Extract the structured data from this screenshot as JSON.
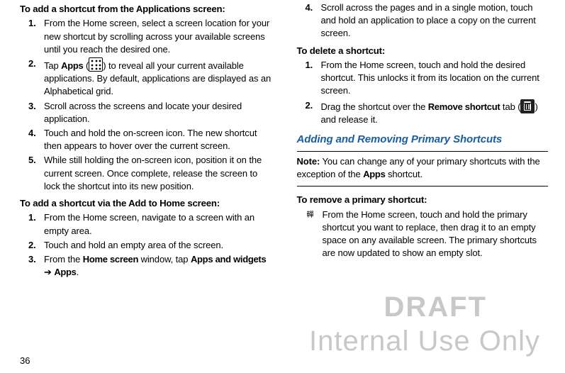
{
  "watermark": {
    "line1": "DRAFT",
    "line2": "Internal Use Only"
  },
  "pageNumber": "36",
  "left": {
    "heading1": "To add a shortcut from the Applications screen:",
    "steps1": [
      "From the Home screen, select a screen location for your new shortcut by scrolling across your available screens until you reach the desired one.",
      "Tap <b>Apps</b> (<span class=\"icon-grid\" data-name=\"apps-grid-icon\" data-interactable=\"false\"></span>) to reveal all your current available applications. By default, applications are displayed as an Alphabetical grid.",
      "Scroll across the screens and locate your desired application.",
      "Touch and hold the on-screen icon. The new shortcut then appears to hover over the current screen.",
      "While still holding the on-screen icon, position it on the current screen. Once complete, release the screen to lock the shortcut into its new position."
    ],
    "heading2": "To add a shortcut via the Add to Home screen:",
    "steps2": [
      "From the Home screen, navigate to a screen with an empty area.",
      "Touch and hold an empty area of the screen.",
      "From the <b>Home screen</b> window, tap <b>Apps and widgets</b> ➔ <b>Apps</b>."
    ]
  },
  "right": {
    "step4": "Scroll across the pages and in a single motion, touch and hold an application to place a copy on the current screen.",
    "heading3": "To delete a shortcut:",
    "steps3": [
      "From the Home screen, touch and hold the desired shortcut. This unlocks it from its location on the current screen.",
      "Drag the shortcut over the <b>Remove shortcut</b> tab (<span class=\"icon-trash\" data-name=\"trash-icon\" data-interactable=\"false\"></span>) and release it."
    ],
    "subheading": "Adding and Removing Primary Shortcuts",
    "noteLabel": "Note:",
    "noteText": "You can change any of your primary shortcuts with the exception of the <b>Apps</b> shortcut.",
    "heading4": "To remove a primary shortcut:",
    "bullet": "From the Home screen, touch and hold the primary shortcut you want to replace, then drag it to an empty space on any available screen. The primary shortcuts are now updated to show an empty slot."
  }
}
